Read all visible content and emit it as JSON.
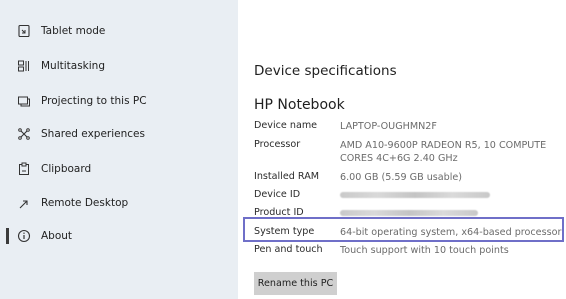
{
  "sidebar": {
    "items": [
      {
        "label": "Tablet mode",
        "icon": "tablet-mode-icon"
      },
      {
        "label": "Multitasking",
        "icon": "multitasking-icon"
      },
      {
        "label": "Projecting to this PC",
        "icon": "projecting-icon"
      },
      {
        "label": "Shared experiences",
        "icon": "shared-experiences-icon"
      },
      {
        "label": "Clipboard",
        "icon": "clipboard-icon"
      },
      {
        "label": "Remote Desktop",
        "icon": "remote-desktop-icon"
      },
      {
        "label": "About",
        "icon": "about-icon",
        "active": true
      }
    ]
  },
  "main": {
    "section_title": "Device specifications",
    "device_title": "HP Notebook",
    "specs": [
      {
        "label": "Device name",
        "value": "LAPTOP-OUGHMN2F"
      },
      {
        "label": "Processor",
        "value": "AMD A10-9600P RADEON R5, 10 COMPUTE CORES 4C+6G   2.40 GHz"
      },
      {
        "label": "Installed RAM",
        "value": "6.00 GB (5.59 GB usable)"
      },
      {
        "label": "Device ID",
        "value": ""
      },
      {
        "label": "Product ID",
        "value": ""
      },
      {
        "label": "System type",
        "value": "64-bit operating system, x64-based processor"
      },
      {
        "label": "Pen and touch",
        "value": "Touch support with 10 touch points"
      }
    ],
    "rename_button": "Rename this PC"
  },
  "colors": {
    "sidebar_bg": "#e9eef3",
    "highlight_border": "#6f6fc8",
    "button_bg": "#cfcfcf"
  }
}
